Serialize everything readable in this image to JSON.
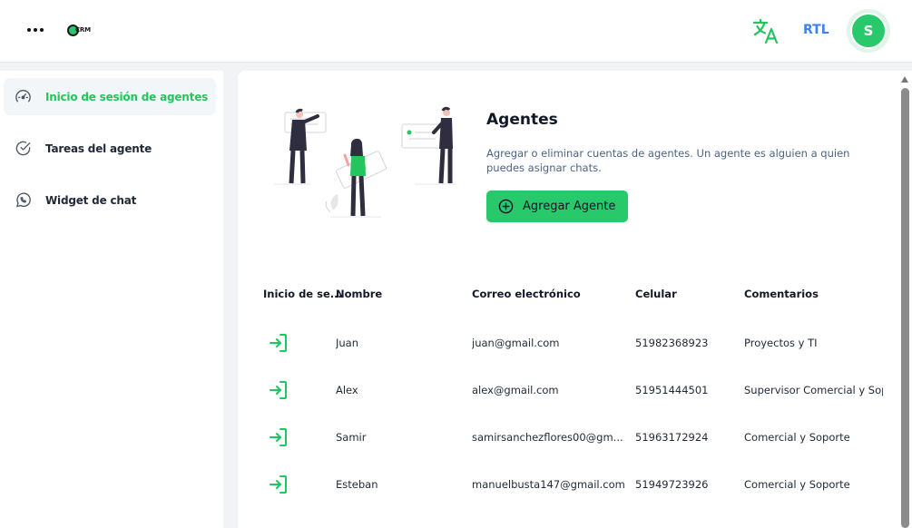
{
  "header": {
    "logo_text": "CRM",
    "rtl_label": "RTL",
    "avatar_initial": "S"
  },
  "sidebar": {
    "items": [
      {
        "label": "Inicio de sesión de agentes",
        "icon": "dashboard-icon",
        "active": true
      },
      {
        "label": "Tareas del agente",
        "icon": "check-circle-icon",
        "active": false
      },
      {
        "label": "Widget de chat",
        "icon": "whatsapp-icon",
        "active": false
      }
    ]
  },
  "hero": {
    "title": "Agentes",
    "description": "Agregar o eliminar cuentas de agentes. Un agente es alguien a quien puedes asignar chats.",
    "add_button_label": "Agregar Agente"
  },
  "table": {
    "columns": [
      "Inicio de se...",
      "Nombre",
      "Correo electrónico",
      "Celular",
      "Comentarios"
    ],
    "rows": [
      {
        "name": "Juan",
        "email": "juan@gmail.com",
        "phone": "51982368923",
        "comment": "Proyectos y TI"
      },
      {
        "name": "Alex",
        "email": "alex@gmail.com",
        "phone": "51951444501",
        "comment": "Supervisor Comercial y Soporte"
      },
      {
        "name": "Samir",
        "email": "samirsanchezflores00@gm...",
        "phone": "51963172924",
        "comment": "Comercial y Soporte"
      },
      {
        "name": "Esteban",
        "email": "manuelbusta147@gmail.com",
        "phone": "51949723926",
        "comment": "Comercial y Soporte"
      }
    ]
  },
  "colors": {
    "accent": "#27c96a",
    "active_text": "#22c55e",
    "rtl": "#3b82f6",
    "description": "#4b6384"
  }
}
